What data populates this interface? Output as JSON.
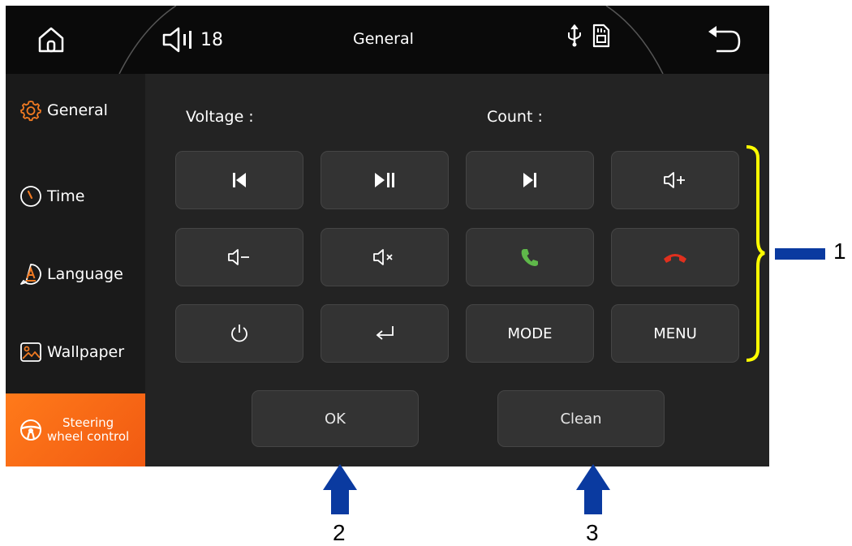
{
  "header": {
    "volume_level": "18",
    "title": "General"
  },
  "sidebar": {
    "items": [
      {
        "label": "General",
        "icon": "gear-icon"
      },
      {
        "label": "Time",
        "icon": "clock-icon"
      },
      {
        "label": "Language",
        "icon": "language-icon"
      },
      {
        "label": "Wallpaper",
        "icon": "wallpaper-icon"
      },
      {
        "label_line1": "Steering",
        "label_line2": "wheel control",
        "icon": "steering-wheel-icon",
        "active": true
      }
    ]
  },
  "info": {
    "voltage_label": "Voltage :",
    "count_label": "Count :"
  },
  "keys": {
    "mode_label": "MODE",
    "menu_label": "MENU"
  },
  "actions": {
    "ok_label": "OK",
    "clean_label": "Clean"
  },
  "callouts": {
    "one": "1",
    "two": "2",
    "three": "3"
  },
  "colors": {
    "accent_orange": "#f26a1b",
    "callout_yellow": "#ffff00",
    "callout_blue": "#0a3aa0",
    "call_green": "#5fb84a",
    "hangup_red": "#e0301e"
  }
}
